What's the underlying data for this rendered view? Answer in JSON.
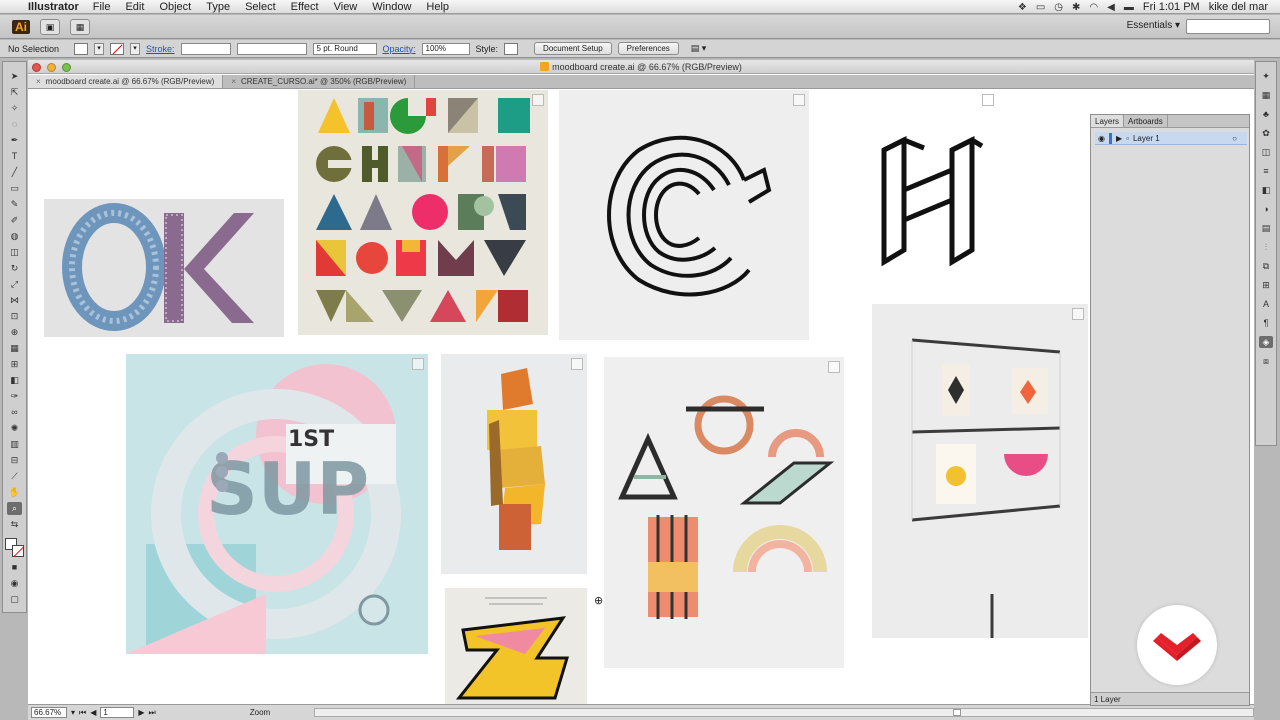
{
  "menubar": {
    "app_name": "Illustrator",
    "items": [
      "File",
      "Edit",
      "Object",
      "Type",
      "Select",
      "Effect",
      "View",
      "Window",
      "Help"
    ],
    "clock": "Fri 1:01 PM",
    "user": "kike del mar"
  },
  "appbar": {
    "logo": "Ai",
    "workspace": "Essentials ▾"
  },
  "controlbar": {
    "selection": "No Selection",
    "stroke_label": "Stroke:",
    "brush": "5 pt. Round",
    "opacity_label": "Opacity:",
    "opacity_value": "100%",
    "style_label": "Style:",
    "document_setup": "Document Setup",
    "preferences": "Preferences"
  },
  "document": {
    "title": "moodboard create.ai @ 66.67% (RGB/Preview)",
    "tabs": [
      {
        "label": "moodboard create.ai @ 66.67% (RGB/Preview)"
      },
      {
        "label": "CREATE_CURSO.ai* @ 350% (RGB/Preview)"
      }
    ],
    "status_zoom": "66.67%",
    "status_artboard": "1",
    "status_tool": "Zoom"
  },
  "layers_panel": {
    "tabs": [
      "Layers",
      "Artboards"
    ],
    "layer_name": "Layer 1",
    "footer": "1 Layer"
  },
  "colors": {
    "accent_blue": "#3a6fd8",
    "selection_row": "#c7d8ef",
    "ai_orange": "#f6a520",
    "watermark_red": "#e4202a"
  }
}
